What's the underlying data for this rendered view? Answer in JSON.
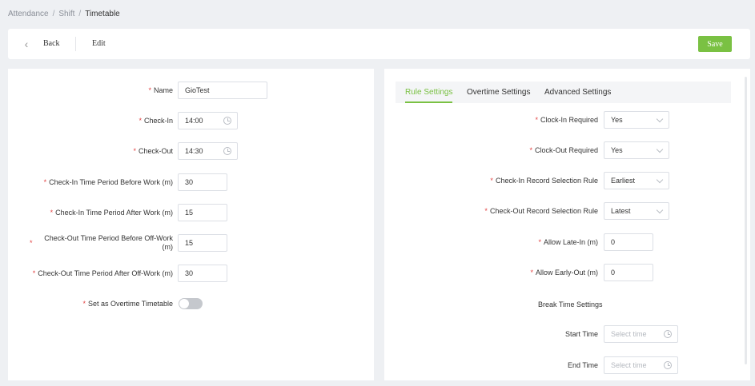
{
  "breadcrumb": [
    "Attendance",
    "Shift",
    "Timetable"
  ],
  "toolbar": {
    "back": "Back",
    "edit": "Edit",
    "save": "Save"
  },
  "left": {
    "name": {
      "label": "Name",
      "value": "GioTest"
    },
    "check_in": {
      "label": "Check-In",
      "value": "14:00"
    },
    "check_out": {
      "label": "Check-Out",
      "value": "14:30"
    },
    "ci_before": {
      "label": "Check-In Time Period Before Work (m)",
      "value": "30"
    },
    "ci_after": {
      "label": "Check-In Time Period After Work (m)",
      "value": "15"
    },
    "co_before": {
      "label": "Check-Out Time Period Before Off-Work (m)",
      "value": "15"
    },
    "co_after": {
      "label": "Check-Out Time Period After Off-Work (m)",
      "value": "30"
    },
    "overtime": {
      "label": "Set as Overtime Timetable",
      "on": false
    }
  },
  "tabs": [
    "Rule Settings",
    "Overtime Settings",
    "Advanced Settings"
  ],
  "right": {
    "clock_in_req": {
      "label": "Clock-In Required",
      "value": "Yes"
    },
    "clock_out_req": {
      "label": "Clock-Out Required",
      "value": "Yes"
    },
    "ci_rule": {
      "label": "Check-In Record Selection Rule",
      "value": "Earliest"
    },
    "co_rule": {
      "label": "Check-Out Record Selection Rule",
      "value": "Latest"
    },
    "late_in": {
      "label": "Allow Late-In (m)",
      "value": "0"
    },
    "early_out": {
      "label": "Allow Early-Out (m)",
      "value": "0"
    },
    "break_title": "Break Time Settings",
    "start_time": {
      "label": "Start Time",
      "placeholder": "Select time"
    },
    "end_time": {
      "label": "End Time",
      "placeholder": "Select time"
    }
  },
  "colors": {
    "accent": "#7ac143",
    "required": "#e24444"
  }
}
